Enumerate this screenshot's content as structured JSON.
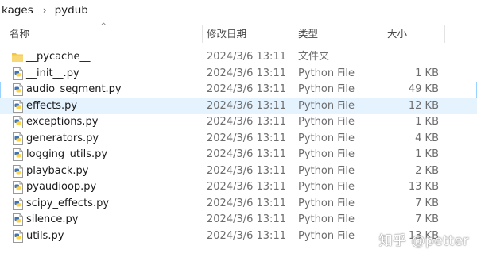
{
  "breadcrumb": {
    "items": [
      "kages",
      "pydub"
    ],
    "separator": "›"
  },
  "columns": {
    "name": "名称",
    "date": "修改日期",
    "type": "类型",
    "size": "大小"
  },
  "files": [
    {
      "icon": "folder-icon",
      "name": "__pycache__",
      "date": "2024/3/6 13:11",
      "type": "文件夹",
      "size": ""
    },
    {
      "icon": "python-file-icon",
      "name": "__init__.py",
      "date": "2024/3/6 13:11",
      "type": "Python File",
      "size": "1 KB"
    },
    {
      "icon": "python-file-icon",
      "name": "audio_segment.py",
      "date": "2024/3/6 13:11",
      "type": "Python File",
      "size": "49 KB"
    },
    {
      "icon": "python-file-icon",
      "name": "effects.py",
      "date": "2024/3/6 13:11",
      "type": "Python File",
      "size": "12 KB"
    },
    {
      "icon": "python-file-icon",
      "name": "exceptions.py",
      "date": "2024/3/6 13:11",
      "type": "Python File",
      "size": "1 KB"
    },
    {
      "icon": "python-file-icon",
      "name": "generators.py",
      "date": "2024/3/6 13:11",
      "type": "Python File",
      "size": "4 KB"
    },
    {
      "icon": "python-file-icon",
      "name": "logging_utils.py",
      "date": "2024/3/6 13:11",
      "type": "Python File",
      "size": "1 KB"
    },
    {
      "icon": "python-file-icon",
      "name": "playback.py",
      "date": "2024/3/6 13:11",
      "type": "Python File",
      "size": "2 KB"
    },
    {
      "icon": "python-file-icon",
      "name": "pyaudioop.py",
      "date": "2024/3/6 13:11",
      "type": "Python File",
      "size": "13 KB"
    },
    {
      "icon": "python-file-icon",
      "name": "scipy_effects.py",
      "date": "2024/3/6 13:11",
      "type": "Python File",
      "size": "7 KB"
    },
    {
      "icon": "python-file-icon",
      "name": "silence.py",
      "date": "2024/3/6 13:11",
      "type": "Python File",
      "size": "7 KB"
    },
    {
      "icon": "python-file-icon",
      "name": "utils.py",
      "date": "2024/3/6 13:11",
      "type": "Python File",
      "size": "13 KB"
    }
  ],
  "watermark": "知乎 @petter",
  "colors": {
    "hover": "#e5f3ff",
    "selected": "#cce8ff",
    "selected_border": "#99d1ff",
    "folder": "#f4c542",
    "python_blue": "#3b73b9",
    "python_yellow": "#ffd343"
  }
}
